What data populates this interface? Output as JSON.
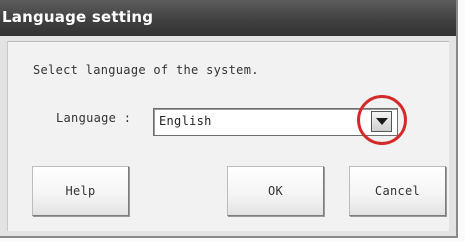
{
  "dialog": {
    "title": "Language setting",
    "instruction": "Select language of the system.",
    "language_label": "Language :",
    "language_value": "English",
    "buttons": {
      "help": "Help",
      "ok": "OK",
      "cancel": "Cancel"
    }
  },
  "icons": {
    "dropdown": "chevron-down-icon",
    "highlight": "red-circle-annotation"
  },
  "colors": {
    "title_bar": "#414141",
    "title_text": "#ffffff",
    "highlight": "#d42a2a"
  }
}
